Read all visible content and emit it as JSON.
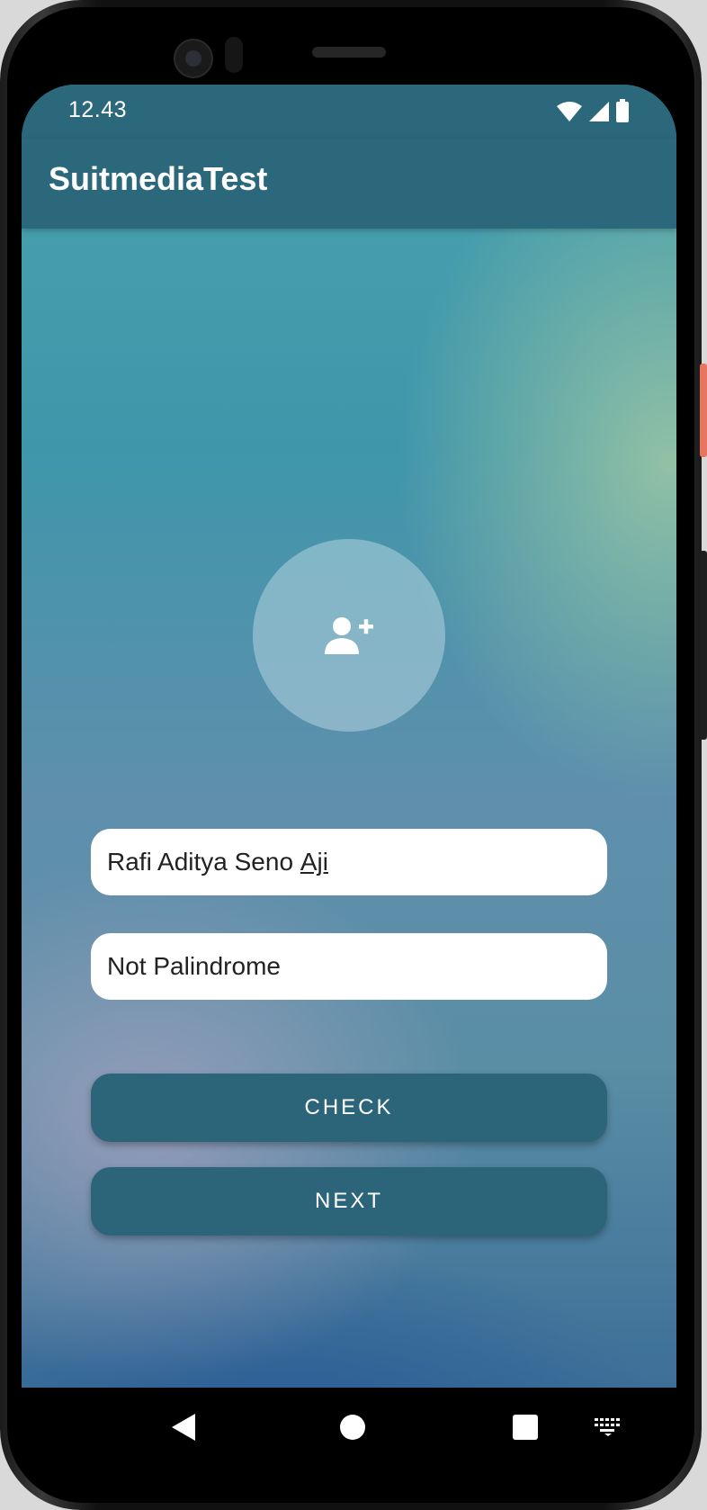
{
  "status_bar": {
    "time": "12.43",
    "icons": [
      "wifi-icon",
      "cellular-signal-icon",
      "battery-icon"
    ]
  },
  "app_bar": {
    "title": "SuitmediaTest"
  },
  "avatar": {
    "icon": "add-user-icon"
  },
  "form": {
    "name_input": {
      "value_main": "Rafi Aditya Seno ",
      "value_underlined": "Aji"
    },
    "palindrome_input": {
      "value": "Not Palindrome"
    },
    "check_label": "CHECK",
    "next_label": "NEXT"
  },
  "nav_bar": {
    "items": [
      "back-icon",
      "home-icon",
      "recents-icon",
      "keyboard-icon"
    ]
  },
  "colors": {
    "primary": "#2c687c",
    "button": "#2c657a",
    "input_bg": "#ffffff"
  }
}
